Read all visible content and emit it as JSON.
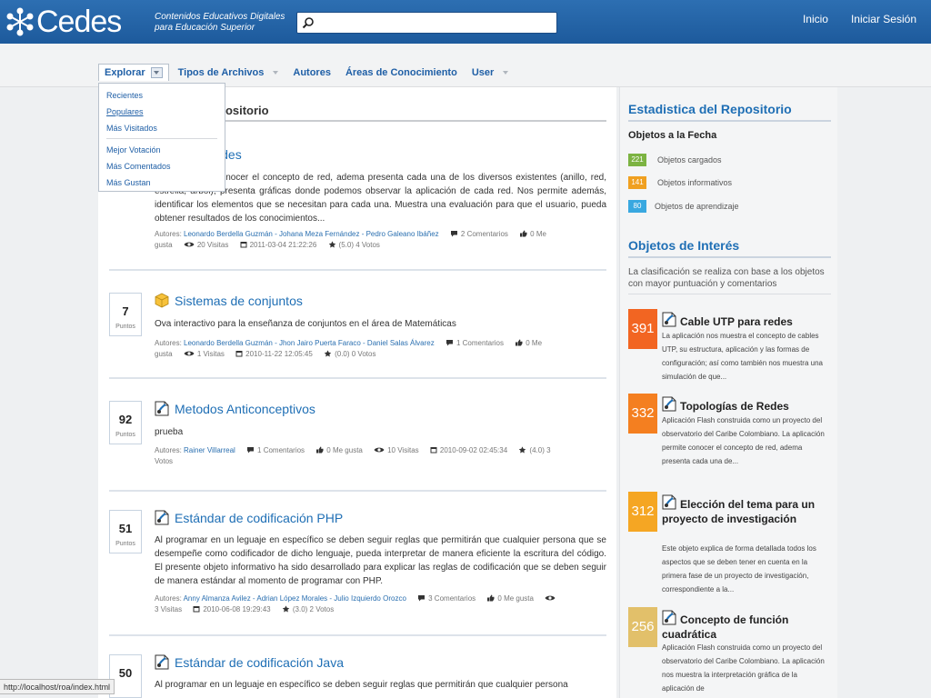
{
  "header": {
    "logo_text": "Cedes",
    "tagline_1": "Contenidos Educativos Digitales",
    "tagline_2": "para Educación Superior",
    "search": {
      "value": "",
      "placeholder": ""
    },
    "nav": [
      "Inicio",
      "Iniciar Sesión"
    ]
  },
  "subnav": {
    "tabs": [
      "Explorar",
      "Tipos de Archivos",
      "Autores",
      "Áreas de Conocimiento",
      "User"
    ]
  },
  "dropdown": {
    "group1": [
      "Recientes",
      "Populares",
      "Más Visitados"
    ],
    "group2": [
      "Mejor Votación",
      "Más Comentados",
      "Más Gustan"
    ]
  },
  "main": {
    "title": "positorio",
    "items": [
      {
        "title": "las de Redes",
        "desc": "n que permite conocer el concepto de red, adema presenta cada una de los diversos existentes (anillo, red, estrella, árbol); presenta gráficas donde podemos observar la aplicación de cada red. Nos permite además, identificar los elementos que se necesitan para cada una. Muestra una evaluación para que el usuario, pueda obtener resultados de los conocimientos...",
        "authors_label": "Autores:",
        "authors": "Leonardo Berdella Guzmán - Johana Meza Fernández - Pedro Galeano Ibáñez",
        "comments": "2 Comentarios",
        "likes_a": "0 Me",
        "likes_b": "gusta",
        "visits": "20 Visitas",
        "date": "2011-03-04 21:22:26",
        "rating": "(5.0) 4 Votos"
      },
      {
        "points": "7",
        "points_label": "Puntos",
        "title": "Sistemas de conjuntos",
        "desc": "Ova interactivo para la enseñanza de conjuntos en el área de Matemáticas",
        "authors_label": "Autores:",
        "authors": "Leonardo Berdella Guzmán - Jhon Jairo Puerta Faraco - Daniel Salas Álvarez",
        "comments": "1 Comentarios",
        "likes_a": "0 Me",
        "likes_b": "gusta",
        "visits": "1 Visitas",
        "date": "2010-11-22 12:05:45",
        "rating": "(0.0) 0 Votos"
      },
      {
        "points": "92",
        "points_label": "Puntos",
        "title": "Metodos Anticonceptivos",
        "desc": "prueba",
        "authors_label": "Autores:",
        "authors": "Rainer Villarreal",
        "comments": "1 Comentarios",
        "likes": "0 Me gusta",
        "visits": "10 Visitas",
        "date": "2010-09-02 02:45:34",
        "rating_a": "(4.0) 3",
        "rating_b": "Votos"
      },
      {
        "points": "51",
        "points_label": "Puntos",
        "title": "Estándar de codificación PHP",
        "desc": "Al programar en un leguaje en específico se deben seguir reglas que permitirán que cualquier persona que se desempeñe como codificador de dicho lenguaje, pueda interpretar de manera eficiente la escritura del código. El presente objeto informativo ha sido desarrollado para explicar las reglas de codificación que se deben seguir de manera estándar al momento de programar con PHP.",
        "authors_label": "Autores:",
        "authors": "Anny Almanza Avilez - Adrian López Morales - Julio Izquierdo Orozco",
        "comments": "3 Comentarios",
        "likes": "0 Me gusta",
        "visits": "3 Visitas",
        "date": "2010-06-08 19:29:43",
        "rating": "(3.0) 2 Votos"
      },
      {
        "points": "50",
        "title": "Estándar de codificación Java",
        "desc": "Al programar en un leguaje en específico se deben seguir reglas que permitirán que cualquier persona"
      }
    ]
  },
  "sidebar": {
    "stats_title": "Estadistica del Repositorio",
    "stats_sub": "Objetos a la Fecha",
    "stats": [
      {
        "count": "221",
        "label": "Objetos cargados",
        "color": "#7cb342"
      },
      {
        "count": "141",
        "label": "Objetos informativos",
        "color": "#f0a020"
      },
      {
        "count": "80",
        "label": "Objetos de aprendizaje",
        "color": "#39a8e0"
      }
    ],
    "interest_title": "Objetos de Interés",
    "interest_intro": "La clasificación se realiza con base a los objetos con mayor puntuación y comentarios",
    "interest": [
      {
        "score": "391",
        "color": "#f26522",
        "title": "Cable UTP para redes",
        "desc": "La aplicación nos muestra el concepto de cables UTP, su estructura, aplicación y las formas de configuración; así como también nos muestra una simulación de que..."
      },
      {
        "score": "332",
        "color": "#f47f20",
        "title": "Topologías de Redes",
        "desc": "Aplicación Flash construida como un proyecto del observatorio del Caribe Colombiano. La aplicación permite conocer el concepto de red, adema presenta cada una de..."
      },
      {
        "score": "312",
        "color": "#f5a623",
        "title": "Elección del tema para un proyecto de investigación",
        "desc": "Este objeto explica de forma detallada todos los aspectos que se deben tener en cuenta en la primera fase de un proyecto de investigación, correspondiente a la..."
      },
      {
        "score": "256",
        "color": "#e2c06a",
        "title": "Concepto de función cuadrática",
        "desc": "Aplicación Flash construida como un proyecto del observatorio del Caribe Colombiano. La aplicación nos muestra la interpretación gráfica de la aplicación de"
      }
    ]
  },
  "statusbar": "http://localhost/roa/index.html"
}
